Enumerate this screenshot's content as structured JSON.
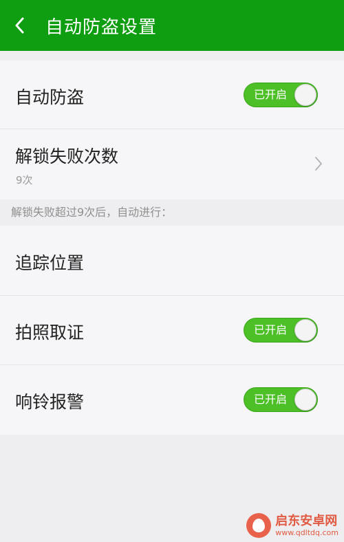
{
  "header": {
    "title": "自动防盗设置",
    "back_icon": "chevron-left-icon",
    "color": "#0f9d12"
  },
  "settings": {
    "auto_theft": {
      "label": "自动防盗",
      "toggle_text": "已开启",
      "on": true
    },
    "unlock_failures": {
      "label": "解锁失败次数",
      "value": "9次",
      "icon": "chevron-right-icon"
    },
    "section_note": "解锁失败超过9次后，自动进行：",
    "track_location": {
      "label": "追踪位置"
    },
    "photo_evidence": {
      "label": "拍照取证",
      "toggle_text": "已开启",
      "on": true
    },
    "ring_alarm": {
      "label": "响铃报警",
      "toggle_text": "已开启",
      "on": true
    }
  },
  "colors": {
    "toggle_on": "#4dbf27",
    "background": "#eeeef0",
    "row": "#f6f6f8"
  },
  "watermark": {
    "name": "启东安卓网",
    "url": "www.qdltdq.com"
  }
}
